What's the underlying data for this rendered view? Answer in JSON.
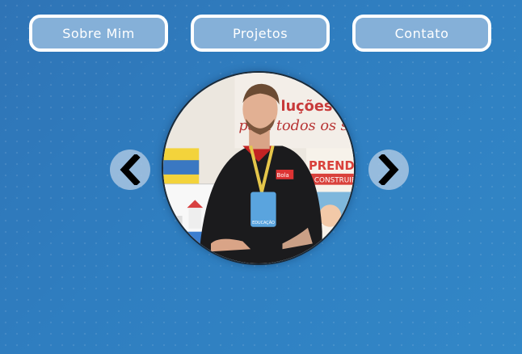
{
  "nav": {
    "items": [
      {
        "label": "Sobre Mim"
      },
      {
        "label": "Projetos"
      },
      {
        "label": "Contato"
      }
    ]
  },
  "carousel": {
    "prev_icon": "chevron-left-icon",
    "next_icon": "chevron-right-icon",
    "photo": {
      "banner_text_1": "luções d",
      "banner_text_2": "para todos os s",
      "banner_text_3": "PRENDER",
      "banner_text_4": "CONSTRUIR",
      "shirt_logo": "Bola",
      "badge_text": "EDUCAÇÃO"
    }
  },
  "colors": {
    "background": "#2f7ec0",
    "button_fill": "#85b0d8",
    "button_border": "#ffffff",
    "arrow_bg": "#a8c6e2"
  }
}
